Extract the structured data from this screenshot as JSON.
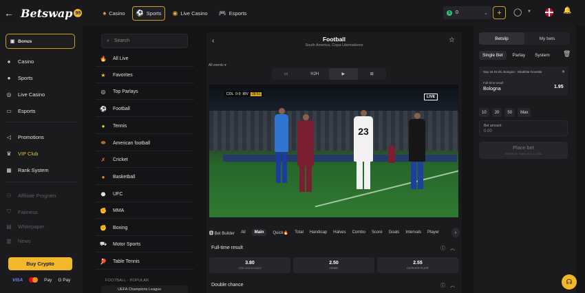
{
  "header": {
    "logo_text": "Betswap",
    "logo_badge": "99",
    "nav": [
      {
        "label": "Casino",
        "icon": "spade-icon"
      },
      {
        "label": "Sports",
        "icon": "soccer-ball-icon",
        "active": true
      },
      {
        "label": "Live Casino",
        "icon": "chip-icon"
      },
      {
        "label": "Esports",
        "icon": "gamepad-icon"
      }
    ],
    "balance": "0"
  },
  "sidebar": {
    "bonus_label": "Bonus",
    "items": [
      {
        "label": "Casino"
      },
      {
        "label": "Sports"
      },
      {
        "label": "Live Casino"
      },
      {
        "label": "Esports"
      },
      {
        "label": "Promotions"
      },
      {
        "label": "VIP Club"
      },
      {
        "label": "Rank System"
      },
      {
        "label": "Affiliate Program"
      },
      {
        "label": "Fairness"
      },
      {
        "label": "Whitepaper"
      },
      {
        "label": "News"
      }
    ],
    "buy_crypto": "Buy Crypto",
    "payments": [
      "VISA",
      "Pay",
      "G Pay"
    ]
  },
  "sports": {
    "search_placeholder": "Search",
    "items": [
      {
        "label": "All Live",
        "icon": "flame-icon"
      },
      {
        "label": "Favorites",
        "icon": "star-icon"
      },
      {
        "label": "Top Parlays",
        "icon": "target-icon"
      },
      {
        "label": "Football",
        "icon": "soccer-ball-icon"
      },
      {
        "label": "Tennis",
        "icon": "tennis-ball-icon"
      },
      {
        "label": "American football",
        "icon": "american-football-icon"
      },
      {
        "label": "Cricket",
        "icon": "cricket-icon"
      },
      {
        "label": "Basketball",
        "icon": "basketball-icon"
      },
      {
        "label": "UFC",
        "icon": "ufc-icon"
      },
      {
        "label": "MMA",
        "icon": "mma-icon"
      },
      {
        "label": "Boxing",
        "icon": "boxing-glove-icon"
      },
      {
        "label": "Motor Sports",
        "icon": "motor-sports-icon"
      },
      {
        "label": "Table Tennis",
        "icon": "table-tennis-icon"
      }
    ],
    "section_label": "FOOTBALL · POPULAR",
    "section_item": "UEFA Champions League"
  },
  "event": {
    "title": "Football",
    "subtitle": "South America, Copa Libertadores",
    "filter": "All events ▾",
    "view_tabs": [
      "",
      "H2H",
      "",
      ""
    ],
    "score": {
      "home": "COL",
      "score": "0-0",
      "away": "RIV",
      "time": "28:51"
    },
    "live_label": "LIVE",
    "jersey_number": "23",
    "market_tabs": [
      "Bet Builder",
      "All",
      "Main",
      "Quick",
      "Total",
      "Handicap",
      "Halves",
      "Combo",
      "Score",
      "Goals",
      "Intervals",
      "Player"
    ],
    "markets": [
      {
        "title": "Full-time result",
        "outcomes": [
          {
            "odd": "3.80",
            "name": "CSD COLO-COLO"
          },
          {
            "odd": "2.50",
            "name": "DRAW"
          },
          {
            "odd": "2.55",
            "name": "CA RIVER PLATE"
          }
        ]
      },
      {
        "title": "Double chance"
      }
    ]
  },
  "betslip": {
    "tabs": [
      "Betslip",
      "My bets"
    ],
    "modes": [
      "Single Bet",
      "Parlay",
      "System"
    ],
    "bet": {
      "match": "Sep 18 22:45, Bologna - Shakhtar Donetsk",
      "market": "Full-time result",
      "selection": "Bologna",
      "odd": "1.95"
    },
    "quick_amounts": [
      "10",
      "20",
      "50",
      "Max"
    ],
    "amount_label": "Bet amount",
    "amount_value": "0.00",
    "place_bet": "Place bet",
    "min_stake": "Minimum stake is 0.1 USD"
  },
  "colors": {
    "accent": "#f2b82c",
    "panel": "#1b1b1e",
    "background": "#141416"
  }
}
